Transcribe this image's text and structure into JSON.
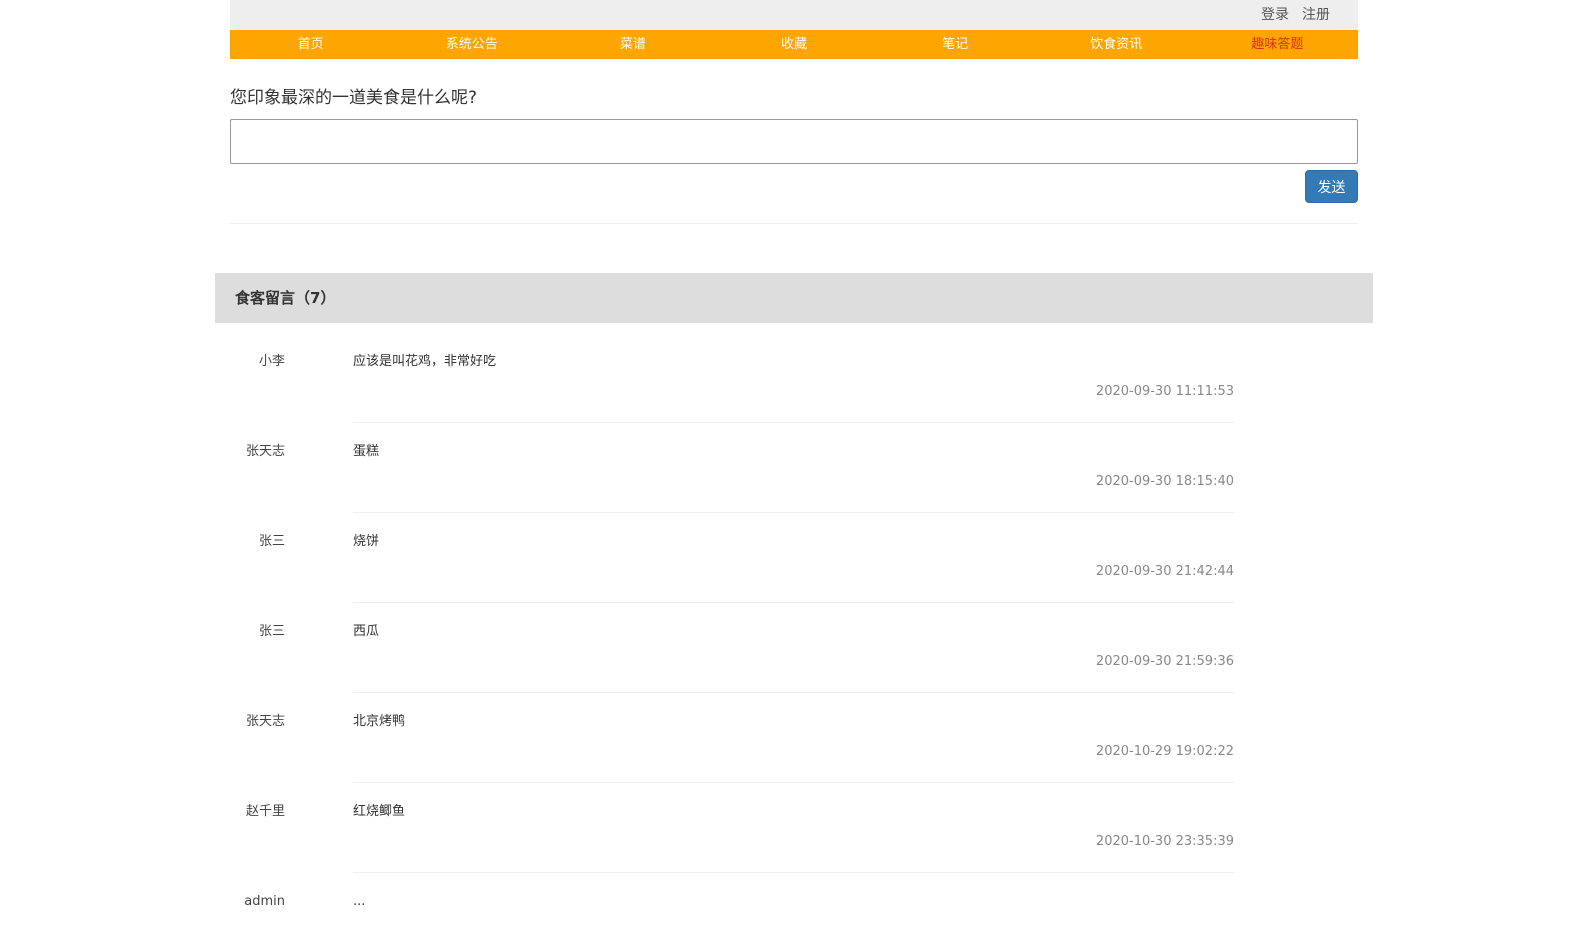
{
  "header": {
    "login_label": "登录",
    "register_label": "注册"
  },
  "nav": {
    "items": [
      {
        "label": "首页"
      },
      {
        "label": "系统公告"
      },
      {
        "label": "菜谱"
      },
      {
        "label": "收藏"
      },
      {
        "label": "笔记"
      },
      {
        "label": "饮食资讯"
      },
      {
        "label": "趣味答题"
      }
    ],
    "active_index": 6
  },
  "form": {
    "question": "您印象最深的一道美食是什么呢?",
    "input_value": "",
    "send_label": "发送"
  },
  "comments_section": {
    "title": "食客留言（7）",
    "items": [
      {
        "author": "小李",
        "text": "应该是叫花鸡，非常好吃",
        "time": "2020-09-30 11:11:53"
      },
      {
        "author": "张天志",
        "text": "蛋糕",
        "time": "2020-09-30 18:15:40"
      },
      {
        "author": "张三",
        "text": "烧饼",
        "time": "2020-09-30 21:42:44"
      },
      {
        "author": "张三",
        "text": "西瓜",
        "time": "2020-09-30 21:59:36"
      },
      {
        "author": "张天志",
        "text": "北京烤鸭",
        "time": "2020-10-29 19:02:22"
      },
      {
        "author": "赵千里",
        "text": "红烧鲫鱼",
        "time": "2020-10-30 23:35:39"
      },
      {
        "author": "admin",
        "text": "...",
        "time": ""
      }
    ]
  },
  "colors": {
    "nav_background": "#ffa500",
    "nav_active_text": "#d9321b",
    "send_button": "#337ab7",
    "section_header_background": "#dddddd",
    "topbar_background": "#eeeeee"
  }
}
